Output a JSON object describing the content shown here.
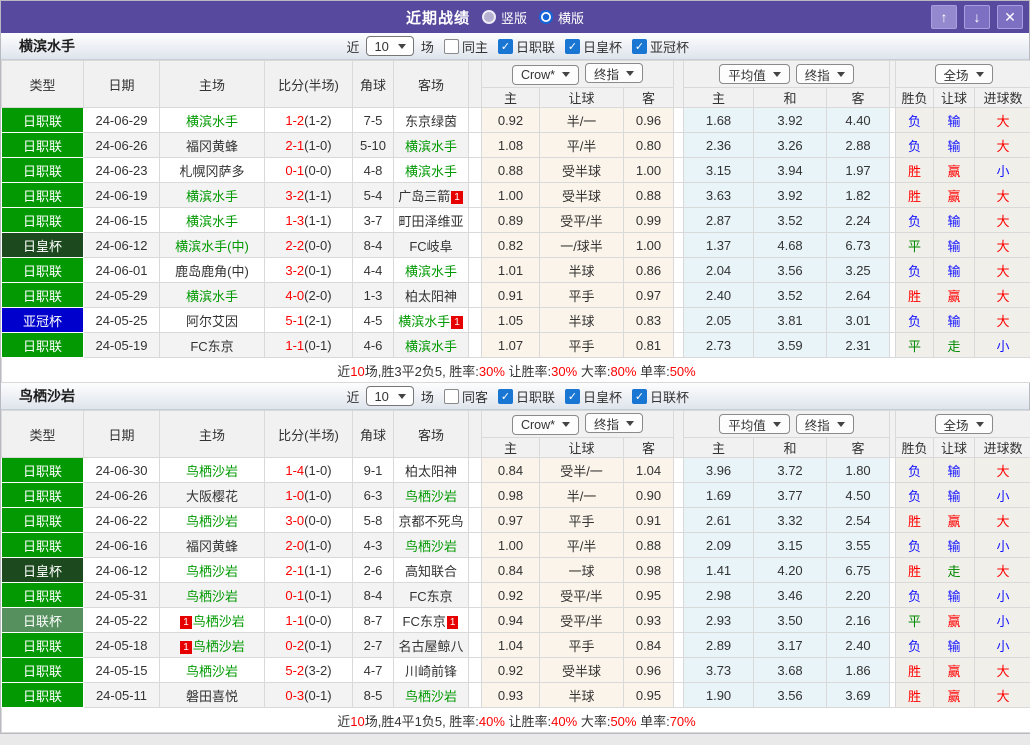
{
  "titlebar": {
    "title": "近期战绩",
    "radios": [
      {
        "label": "竖版",
        "selected": false
      },
      {
        "label": "横版",
        "selected": true
      }
    ],
    "icons": {
      "up": "↑",
      "down": "↓",
      "close": "✕"
    }
  },
  "colors": {
    "titlebar_purple": "#57499e",
    "league_badge_green": "#029902",
    "emperor_cup_dark_green": "#1c4a1e",
    "acl_blue": "#0000cc",
    "league_cup_sage": "#55905e",
    "team_name_green": "#009900",
    "win_red": "#ff0000",
    "lose_blue": "#1414ff",
    "draw_green": "#008800",
    "score_red": "#ff0000",
    "red_card_badge": "#e60000"
  },
  "col_headers": {
    "left": [
      "类型",
      "日期",
      "主场",
      "比分(半场)",
      "角球",
      "客场"
    ],
    "dd_group1": [
      "Crow*",
      "终指"
    ],
    "dd_group2": [
      "平均值",
      "终指"
    ],
    "dd_group3": [
      "全场"
    ],
    "sub": [
      "主",
      "让球",
      "客",
      "主",
      "和",
      "客",
      "胜负",
      "让球",
      "进球数"
    ]
  },
  "sections": [
    {
      "team": "横滨水手",
      "filter": {
        "prefix": "近",
        "count": "10",
        "suffix": "场",
        "same": {
          "label": "同主",
          "checked": false
        },
        "leagues": [
          {
            "label": "日职联",
            "checked": true
          },
          {
            "label": "日皇杯",
            "checked": true
          },
          {
            "label": "亚冠杯",
            "checked": true
          }
        ]
      },
      "rows": [
        {
          "type": "日职联",
          "type_style": "jl",
          "date": "24-06-29",
          "home": {
            "name": "横滨水手",
            "green": true
          },
          "score_ft": "1-2",
          "score_ht": "(1-2)",
          "corner": "7-5",
          "away": {
            "name": "东京绿茵"
          },
          "odds1": [
            "0.92",
            "半/一",
            "0.96"
          ],
          "avg": [
            "1.68",
            "3.92",
            "4.40"
          ],
          "result": [
            {
              "text": "负",
              "color": "blue"
            },
            {
              "text": "输",
              "color": "blue"
            },
            {
              "text": "大",
              "color": "red"
            }
          ]
        },
        {
          "type": "日职联",
          "type_style": "jl",
          "date": "24-06-26",
          "home": {
            "name": "福冈黄蜂"
          },
          "score_ft": "2-1",
          "score_ht": "(1-0)",
          "corner": "5-10",
          "away": {
            "name": "横滨水手",
            "green": true
          },
          "odds1": [
            "1.08",
            "平/半",
            "0.80"
          ],
          "avg": [
            "2.36",
            "3.26",
            "2.88"
          ],
          "result": [
            {
              "text": "负",
              "color": "blue"
            },
            {
              "text": "输",
              "color": "blue"
            },
            {
              "text": "大",
              "color": "red"
            }
          ]
        },
        {
          "type": "日职联",
          "type_style": "jl",
          "date": "24-06-23",
          "home": {
            "name": "札幌冈萨多"
          },
          "score_ft": "0-1",
          "score_ht": "(0-0)",
          "corner": "4-8",
          "away": {
            "name": "横滨水手",
            "green": true
          },
          "odds1": [
            "0.88",
            "受半球",
            "1.00"
          ],
          "avg": [
            "3.15",
            "3.94",
            "1.97"
          ],
          "result": [
            {
              "text": "胜",
              "color": "red"
            },
            {
              "text": "赢",
              "color": "red"
            },
            {
              "text": "小",
              "color": "blue"
            }
          ]
        },
        {
          "type": "日职联",
          "type_style": "jl",
          "date": "24-06-19",
          "home": {
            "name": "横滨水手",
            "green": true
          },
          "score_ft": "3-2",
          "score_ht": "(1-1)",
          "corner": "5-4",
          "away": {
            "name": "广岛三箭",
            "red_card_after": true
          },
          "odds1": [
            "1.00",
            "受半球",
            "0.88"
          ],
          "avg": [
            "3.63",
            "3.92",
            "1.82"
          ],
          "result": [
            {
              "text": "胜",
              "color": "red"
            },
            {
              "text": "赢",
              "color": "red"
            },
            {
              "text": "大",
              "color": "red"
            }
          ]
        },
        {
          "type": "日职联",
          "type_style": "jl",
          "date": "24-06-15",
          "home": {
            "name": "横滨水手",
            "green": true
          },
          "score_ft": "1-3",
          "score_ht": "(1-1)",
          "corner": "3-7",
          "away": {
            "name": "町田泽维亚"
          },
          "odds1": [
            "0.89",
            "受平/半",
            "0.99"
          ],
          "avg": [
            "2.87",
            "3.52",
            "2.24"
          ],
          "result": [
            {
              "text": "负",
              "color": "blue"
            },
            {
              "text": "输",
              "color": "blue"
            },
            {
              "text": "大",
              "color": "red"
            }
          ]
        },
        {
          "type": "日皇杯",
          "type_style": "jhb",
          "date": "24-06-12",
          "home": {
            "name": "横滨水手(中)",
            "green": true
          },
          "score_ft": "2-2",
          "score_ht": "(0-0)",
          "corner": "8-4",
          "away": {
            "name": "FC岐阜"
          },
          "odds1": [
            "0.82",
            "一/球半",
            "1.00"
          ],
          "avg": [
            "1.37",
            "4.68",
            "6.73"
          ],
          "result": [
            {
              "text": "平",
              "color": "green"
            },
            {
              "text": "输",
              "color": "blue"
            },
            {
              "text": "大",
              "color": "red"
            }
          ]
        },
        {
          "type": "日职联",
          "type_style": "jl",
          "date": "24-06-01",
          "home": {
            "name": "鹿岛鹿角(中)"
          },
          "score_ft": "3-2",
          "score_ht": "(0-1)",
          "corner": "4-4",
          "away": {
            "name": "横滨水手",
            "green": true
          },
          "odds1": [
            "1.01",
            "半球",
            "0.86"
          ],
          "avg": [
            "2.04",
            "3.56",
            "3.25"
          ],
          "result": [
            {
              "text": "负",
              "color": "blue"
            },
            {
              "text": "输",
              "color": "blue"
            },
            {
              "text": "大",
              "color": "red"
            }
          ]
        },
        {
          "type": "日职联",
          "type_style": "jl",
          "date": "24-05-29",
          "home": {
            "name": "横滨水手",
            "green": true
          },
          "score_ft": "4-0",
          "score_ht": "(2-0)",
          "corner": "1-3",
          "away": {
            "name": "柏太阳神"
          },
          "odds1": [
            "0.91",
            "平手",
            "0.97"
          ],
          "avg": [
            "2.40",
            "3.52",
            "2.64"
          ],
          "result": [
            {
              "text": "胜",
              "color": "red"
            },
            {
              "text": "赢",
              "color": "red"
            },
            {
              "text": "大",
              "color": "red"
            }
          ]
        },
        {
          "type": "亚冠杯",
          "type_style": "ygb",
          "date": "24-05-25",
          "home": {
            "name": "阿尔艾因"
          },
          "score_ft": "5-1",
          "score_ht": "(2-1)",
          "corner": "4-5",
          "away": {
            "name": "横滨水手",
            "green": true,
            "red_card_after": true
          },
          "odds1": [
            "1.05",
            "半球",
            "0.83"
          ],
          "avg": [
            "2.05",
            "3.81",
            "3.01"
          ],
          "result": [
            {
              "text": "负",
              "color": "blue"
            },
            {
              "text": "输",
              "color": "blue"
            },
            {
              "text": "大",
              "color": "red"
            }
          ]
        },
        {
          "type": "日职联",
          "type_style": "jl",
          "date": "24-05-19",
          "home": {
            "name": "FC东京"
          },
          "score_ft": "1-1",
          "score_ht": "(0-1)",
          "corner": "4-6",
          "away": {
            "name": "横滨水手",
            "green": true
          },
          "odds1": [
            "1.07",
            "平手",
            "0.81"
          ],
          "avg": [
            "2.73",
            "3.59",
            "2.31"
          ],
          "result": [
            {
              "text": "平",
              "color": "green"
            },
            {
              "text": "走",
              "color": "green"
            },
            {
              "text": "小",
              "color": "blue"
            }
          ]
        }
      ],
      "summary": [
        {
          "t": "近"
        },
        {
          "t": "10",
          "red": true
        },
        {
          "t": "场,胜3平2负5, 胜率:"
        },
        {
          "t": "30%",
          "red": true
        },
        {
          "t": " 让胜率:"
        },
        {
          "t": "30%",
          "red": true
        },
        {
          "t": " 大率:"
        },
        {
          "t": "80%",
          "red": true
        },
        {
          "t": " 单率:"
        },
        {
          "t": "50%",
          "red": true
        }
      ]
    },
    {
      "team": "鸟栖沙岩",
      "filter": {
        "prefix": "近",
        "count": "10",
        "suffix": "场",
        "same": {
          "label": "同客",
          "checked": false
        },
        "leagues": [
          {
            "label": "日职联",
            "checked": true
          },
          {
            "label": "日皇杯",
            "checked": true
          },
          {
            "label": "日联杯",
            "checked": true
          }
        ]
      },
      "rows": [
        {
          "type": "日职联",
          "type_style": "jl",
          "date": "24-06-30",
          "home": {
            "name": "鸟栖沙岩",
            "green": true
          },
          "score_ft": "1-4",
          "score_ht": "(1-0)",
          "corner": "9-1",
          "away": {
            "name": "柏太阳神"
          },
          "odds1": [
            "0.84",
            "受半/一",
            "1.04"
          ],
          "avg": [
            "3.96",
            "3.72",
            "1.80"
          ],
          "result": [
            {
              "text": "负",
              "color": "blue"
            },
            {
              "text": "输",
              "color": "blue"
            },
            {
              "text": "大",
              "color": "red"
            }
          ]
        },
        {
          "type": "日职联",
          "type_style": "jl",
          "date": "24-06-26",
          "home": {
            "name": "大阪樱花"
          },
          "score_ft": "1-0",
          "score_ht": "(1-0)",
          "corner": "6-3",
          "away": {
            "name": "鸟栖沙岩",
            "green": true
          },
          "odds1": [
            "0.98",
            "半/一",
            "0.90"
          ],
          "avg": [
            "1.69",
            "3.77",
            "4.50"
          ],
          "result": [
            {
              "text": "负",
              "color": "blue"
            },
            {
              "text": "输",
              "color": "blue"
            },
            {
              "text": "小",
              "color": "blue"
            }
          ]
        },
        {
          "type": "日职联",
          "type_style": "jl",
          "date": "24-06-22",
          "home": {
            "name": "鸟栖沙岩",
            "green": true
          },
          "score_ft": "3-0",
          "score_ht": "(0-0)",
          "corner": "5-8",
          "away": {
            "name": "京都不死鸟"
          },
          "odds1": [
            "0.97",
            "平手",
            "0.91"
          ],
          "avg": [
            "2.61",
            "3.32",
            "2.54"
          ],
          "result": [
            {
              "text": "胜",
              "color": "red"
            },
            {
              "text": "赢",
              "color": "red"
            },
            {
              "text": "大",
              "color": "red"
            }
          ]
        },
        {
          "type": "日职联",
          "type_style": "jl",
          "date": "24-06-16",
          "home": {
            "name": "福冈黄蜂"
          },
          "score_ft": "2-0",
          "score_ht": "(1-0)",
          "corner": "4-3",
          "away": {
            "name": "鸟栖沙岩",
            "green": true
          },
          "odds1": [
            "1.00",
            "平/半",
            "0.88"
          ],
          "avg": [
            "2.09",
            "3.15",
            "3.55"
          ],
          "result": [
            {
              "text": "负",
              "color": "blue"
            },
            {
              "text": "输",
              "color": "blue"
            },
            {
              "text": "小",
              "color": "blue"
            }
          ]
        },
        {
          "type": "日皇杯",
          "type_style": "jhb",
          "date": "24-06-12",
          "home": {
            "name": "鸟栖沙岩",
            "green": true
          },
          "score_ft": "2-1",
          "score_ht": "(1-1)",
          "corner": "2-6",
          "away": {
            "name": "高知联合"
          },
          "odds1": [
            "0.84",
            "一球",
            "0.98"
          ],
          "avg": [
            "1.41",
            "4.20",
            "6.75"
          ],
          "result": [
            {
              "text": "胜",
              "color": "red"
            },
            {
              "text": "走",
              "color": "green"
            },
            {
              "text": "大",
              "color": "red"
            }
          ]
        },
        {
          "type": "日职联",
          "type_style": "jl",
          "date": "24-05-31",
          "home": {
            "name": "鸟栖沙岩",
            "green": true
          },
          "score_ft": "0-1",
          "score_ht": "(0-1)",
          "corner": "8-4",
          "away": {
            "name": "FC东京"
          },
          "odds1": [
            "0.92",
            "受平/半",
            "0.95"
          ],
          "avg": [
            "2.98",
            "3.46",
            "2.20"
          ],
          "result": [
            {
              "text": "负",
              "color": "blue"
            },
            {
              "text": "输",
              "color": "blue"
            },
            {
              "text": "小",
              "color": "blue"
            }
          ]
        },
        {
          "type": "日联杯",
          "type_style": "ylb",
          "date": "24-05-22",
          "home": {
            "name": "鸟栖沙岩",
            "green": true,
            "red_card_before": true
          },
          "score_ft": "1-1",
          "score_ht": "(0-0)",
          "corner": "8-7",
          "away": {
            "name": "FC东京",
            "red_card_after": true
          },
          "odds1": [
            "0.94",
            "受平/半",
            "0.93"
          ],
          "avg": [
            "2.93",
            "3.50",
            "2.16"
          ],
          "result": [
            {
              "text": "平",
              "color": "green"
            },
            {
              "text": "赢",
              "color": "red"
            },
            {
              "text": "小",
              "color": "blue"
            }
          ]
        },
        {
          "type": "日职联",
          "type_style": "jl",
          "date": "24-05-18",
          "home": {
            "name": "鸟栖沙岩",
            "green": true,
            "red_card_before": true
          },
          "score_ft": "0-2",
          "score_ht": "(0-1)",
          "corner": "2-7",
          "away": {
            "name": "名古屋鲸八"
          },
          "odds1": [
            "1.04",
            "平手",
            "0.84"
          ],
          "avg": [
            "2.89",
            "3.17",
            "2.40"
          ],
          "result": [
            {
              "text": "负",
              "color": "blue"
            },
            {
              "text": "输",
              "color": "blue"
            },
            {
              "text": "小",
              "color": "blue"
            }
          ]
        },
        {
          "type": "日职联",
          "type_style": "jl",
          "date": "24-05-15",
          "home": {
            "name": "鸟栖沙岩",
            "green": true
          },
          "score_ft": "5-2",
          "score_ht": "(3-2)",
          "corner": "4-7",
          "away": {
            "name": "川崎前锋"
          },
          "odds1": [
            "0.92",
            "受半球",
            "0.96"
          ],
          "avg": [
            "3.73",
            "3.68",
            "1.86"
          ],
          "result": [
            {
              "text": "胜",
              "color": "red"
            },
            {
              "text": "赢",
              "color": "red"
            },
            {
              "text": "大",
              "color": "red"
            }
          ]
        },
        {
          "type": "日职联",
          "type_style": "jl",
          "date": "24-05-11",
          "home": {
            "name": "磐田喜悦"
          },
          "score_ft": "0-3",
          "score_ht": "(0-1)",
          "corner": "8-5",
          "away": {
            "name": "鸟栖沙岩",
            "green": true
          },
          "odds1": [
            "0.93",
            "半球",
            "0.95"
          ],
          "avg": [
            "1.90",
            "3.56",
            "3.69"
          ],
          "result": [
            {
              "text": "胜",
              "color": "red"
            },
            {
              "text": "赢",
              "color": "red"
            },
            {
              "text": "大",
              "color": "red"
            }
          ]
        }
      ],
      "summary": [
        {
          "t": "近"
        },
        {
          "t": "10",
          "red": true
        },
        {
          "t": "场,胜4平1负5, 胜率:"
        },
        {
          "t": "40%",
          "red": true
        },
        {
          "t": " 让胜率:"
        },
        {
          "t": "40%",
          "red": true
        },
        {
          "t": " 大率:"
        },
        {
          "t": "50%",
          "red": true
        },
        {
          "t": " 单率:"
        },
        {
          "t": "70%",
          "red": true
        }
      ]
    }
  ]
}
